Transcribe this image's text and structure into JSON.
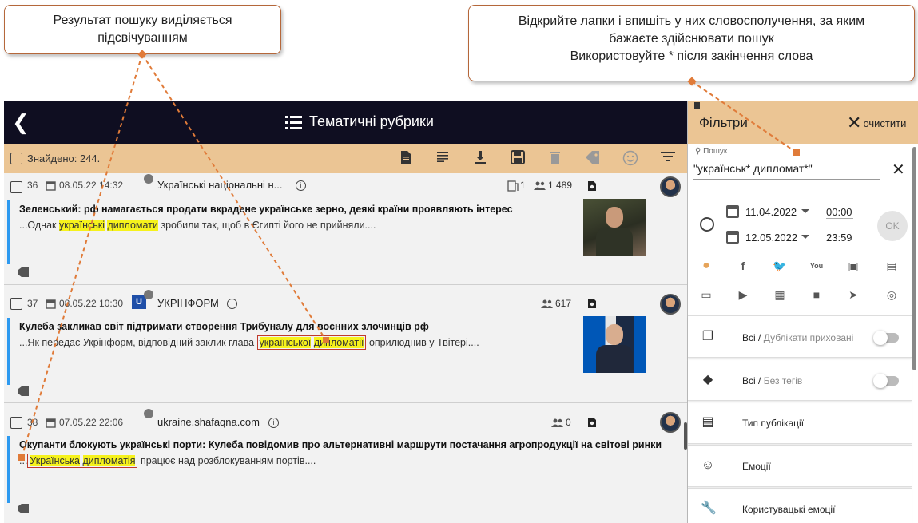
{
  "callouts": {
    "left_line1": "Результат пошуку виділяється",
    "left_line2": "підсвічуванням",
    "right_line1": "Відкрийте лапки і впишіть у них словосполучення, за яким",
    "right_line2": "бажаєте здійснювати пошук",
    "right_line3": "Використовуйте  * після закінчення слова"
  },
  "header": {
    "back": "❮",
    "title": "Тематичні рубрики"
  },
  "toolbar": {
    "found": "Знайдено: 244."
  },
  "articles": [
    {
      "num": "36",
      "date": "08.05.22 14:32",
      "source": "Українські національні н...",
      "dup_count": "1",
      "readers": "1 489",
      "headline": "Зеленський: рф намагається продати вкрадене українське зерно, деякі країни проявляють інтерес",
      "snippet_pre": "...Однак ",
      "hl1": "українські",
      "hl_sep": " ",
      "hl2": "дипломати",
      "snippet_post": " зробили так, щоб в Єгипті його не прийняли...."
    },
    {
      "num": "37",
      "date": "08.05.22 10:30",
      "source": "УКРІНФОРМ",
      "source_logo": "U",
      "readers": "617",
      "headline": "Кулеба закликав світ підтримати створення Трибуналу для воєнних злочинців рф",
      "snippet_pre": "...Як передає Укрінформ, відповідний заклик глава ",
      "hl1": "української",
      "hl_sep": " ",
      "hl2": "дипломатії",
      "snippet_post": " оприлюднив у Твітері...."
    },
    {
      "num": "38",
      "date": "07.05.22 22:06",
      "source": "ukraine.shafaqna.com",
      "readers": "0",
      "headline": "Окупанти блокують українські порти: Кулеба повідомив про альтернативні маршрути постачання агропродукції на світові ринки",
      "snippet_pre": "...",
      "hl1": "Українська",
      "hl_sep": " ",
      "hl2": "дипломатія",
      "snippet_post": " працює над розблокуванням портів...."
    }
  ],
  "filters": {
    "title": "Фільтри",
    "clear": "очистити",
    "search_label": "Пошук",
    "search_value": "\"українськ* дипломат*\"",
    "date_from": "11.04.2022",
    "time_from": "00:00",
    "date_to": "12.05.2022",
    "time_to": "23:59",
    "ok": "OK",
    "rows": [
      {
        "main": "Всі",
        "sub": "Дублікати приховані"
      },
      {
        "main": "Всі",
        "sub": "Без тегів"
      },
      {
        "main": "Тип публікації"
      },
      {
        "main": "Емоції"
      },
      {
        "main": "Користувацькі емоції"
      }
    ],
    "sources": [
      "web-icon",
      "facebook-icon",
      "twitter-icon",
      "youtube-icon",
      "person-card-icon",
      "newspaper-icon",
      "comment-icon",
      "tv-icon",
      "radio-icon",
      "forum-icon",
      "telegram-icon",
      "instagram-icon"
    ]
  },
  "colors": {
    "accent": "#ebc594",
    "dark": "#0f0e21",
    "highlight": "#f6f21c",
    "bar": "#2e9af0",
    "arrow": "#e07b39"
  }
}
